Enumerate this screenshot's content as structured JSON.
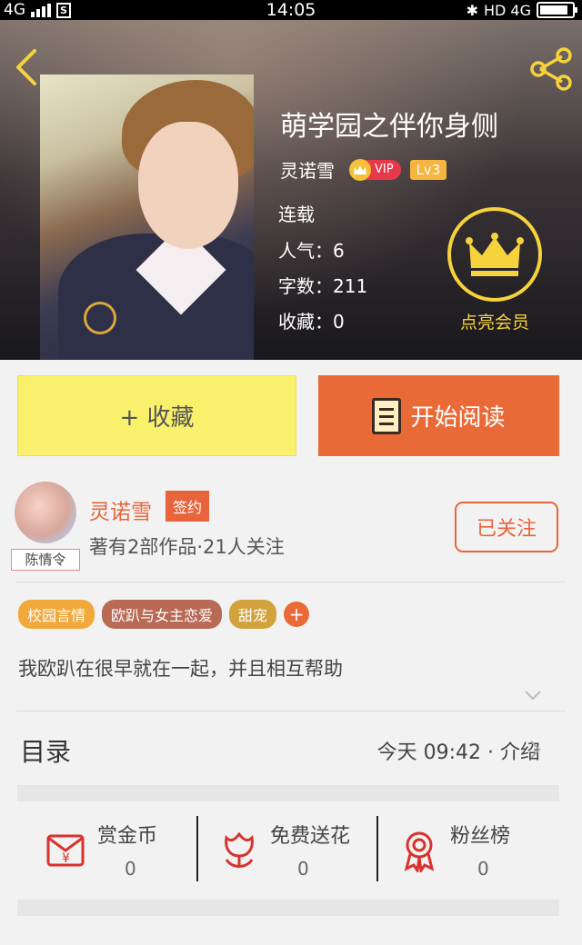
{
  "status_bar": {
    "network": "4G",
    "sim_icon": "S",
    "time": "14:05",
    "right_indicator": "HD 4G"
  },
  "header": {
    "back_icon": "back-chevron-icon",
    "share_icon": "share-icon"
  },
  "book": {
    "title": "萌学园之伴你身侧",
    "author": "灵诺雪",
    "vip_label": "VIP",
    "level": "Lv3",
    "status": "连载",
    "popularity": "人气：6",
    "word_count": "字数：211",
    "favorites": "收藏：0"
  },
  "member": {
    "label": "点亮会员",
    "icon": "crown-icon",
    "color": "#f6d33c"
  },
  "actions": {
    "favorite_label": "+ 收藏",
    "read_label": "开始阅读"
  },
  "author_card": {
    "name": "灵诺雪",
    "sign_badge": "签约",
    "avatar_tag": "陈情令",
    "meta": "著有2部作品·21人关注",
    "follow_label": "已关注"
  },
  "tags": [
    {
      "label": "校园言情",
      "color": "#f2a93b"
    },
    {
      "label": "欧趴与女主恋爱",
      "color": "#b86a55"
    },
    {
      "label": "甜宠",
      "color": "#d2a23c"
    }
  ],
  "tag_add_label": "+",
  "description": "我欧趴在很早就在一起，并且相互帮助",
  "toc": {
    "title": "目录",
    "update": "今天 09:42 · 介绍"
  },
  "rewards": [
    {
      "label": "赏金币",
      "value": "0",
      "icon": "red-envelope-icon"
    },
    {
      "label": "免费送花",
      "value": "0",
      "icon": "flower-icon"
    },
    {
      "label": "粉丝榜",
      "value": "0",
      "icon": "ribbon-award-icon"
    }
  ],
  "colors": {
    "accent": "#ea6a37",
    "favorite_bg": "#f9f06c",
    "icon_red": "#d9322e"
  }
}
